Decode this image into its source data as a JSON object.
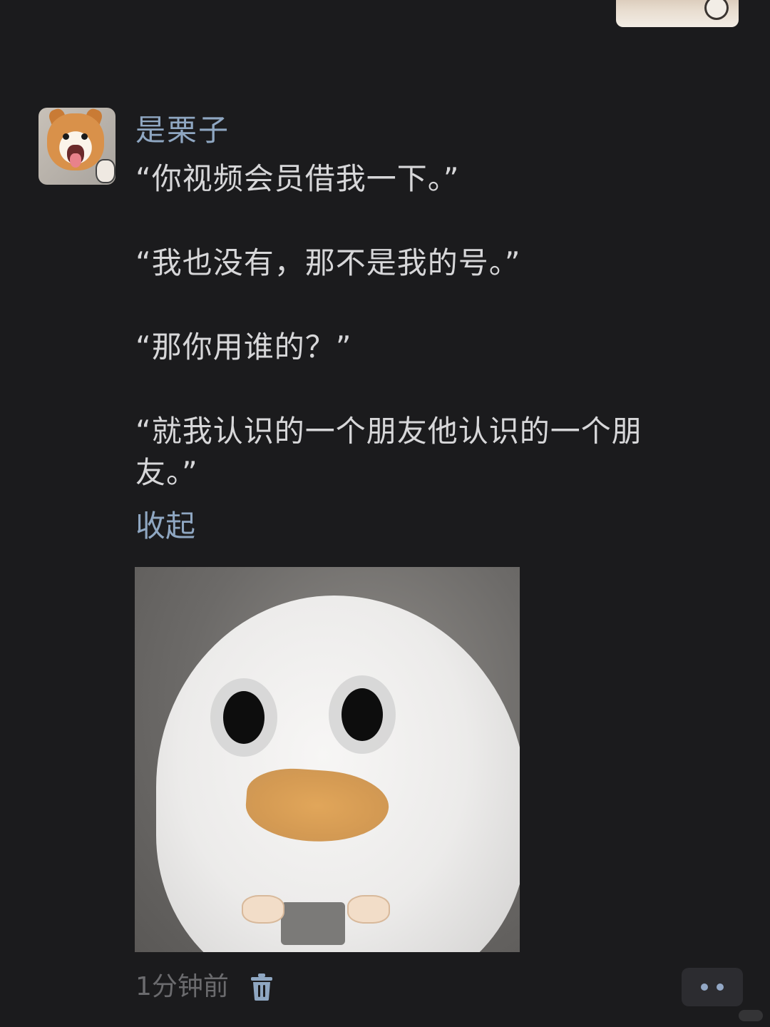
{
  "comment": {
    "username": "是栗子",
    "lines": [
      "“你视频会员借我一下。”",
      "“我也没有，那不是我的号。”",
      "“那你用谁的？”",
      "“就我认识的一个朋友他认识的一个朋友。”"
    ],
    "collapse_label": "收起",
    "timestamp": "1分钟前"
  },
  "icons": {
    "delete": "trash-icon",
    "more": "more-dots-icon"
  },
  "colors": {
    "background": "#1b1b1d",
    "link": "#8fa7c2",
    "text": "#d7d7d9",
    "muted": "#6b6b6e"
  }
}
